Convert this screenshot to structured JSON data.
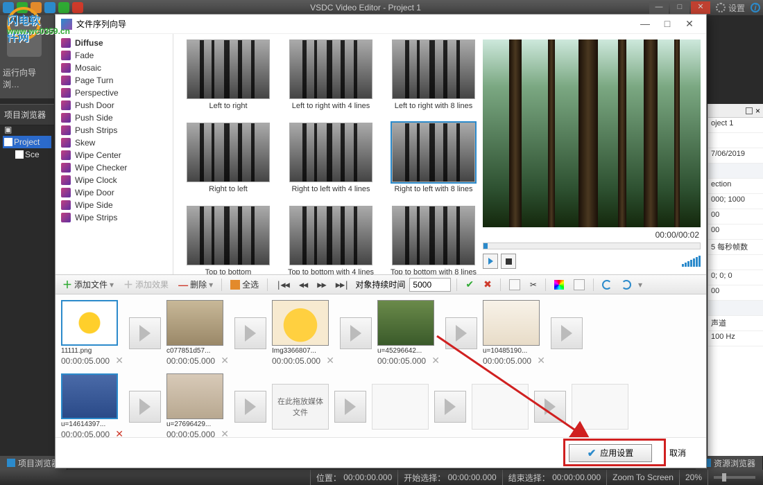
{
  "app": {
    "title": "VSDC Video Editor - Project 1"
  },
  "titlebar": {
    "settings": "设置"
  },
  "window_controls": {
    "min": "—",
    "max": "□",
    "close": "✕"
  },
  "watermark": {
    "line1": "闪电软件网",
    "line2": "www.wc0359.cn"
  },
  "left": {
    "wizard": "运行向导",
    "browse": "浏…",
    "browser_header": "项目浏览器",
    "project": "Project",
    "scene": "Sce"
  },
  "right_header": {
    "pin": "📌",
    "close": "×"
  },
  "properties": [
    {
      "v": "oject 1",
      "h": false
    },
    {
      "v": "",
      "h": false
    },
    {
      "v": "7/06/2019",
      "h": false
    },
    {
      "v": "",
      "h": true
    },
    {
      "v": "ection",
      "h": false
    },
    {
      "v": "000; 1000",
      "h": false
    },
    {
      "v": "00",
      "h": false
    },
    {
      "v": "00",
      "h": false
    },
    {
      "v": "5 每秒帧数",
      "h": false
    },
    {
      "v": "",
      "h": false
    },
    {
      "v": "0; 0; 0",
      "h": false
    },
    {
      "v": "00",
      "h": false
    },
    {
      "v": "",
      "h": true
    },
    {
      "v": "声道",
      "h": false
    },
    {
      "v": "100 Hz",
      "h": false
    }
  ],
  "dialog": {
    "title": "文件序列向导",
    "min": "—",
    "max": "□",
    "close": "✕",
    "effects": [
      "Diffuse",
      "Fade",
      "Mosaic",
      "Page Turn",
      "Perspective",
      "Push Door",
      "Push Side",
      "Push Strips",
      "Skew",
      "Wipe Center",
      "Wipe Checker",
      "Wipe Clock",
      "Wipe Door",
      "Wipe Side",
      "Wipe Strips"
    ],
    "effect_selected": 0,
    "thumbs": [
      "Left to right",
      "Left to right with 4 lines",
      "Left to right with 8 lines",
      "Right to left",
      "Right to left with 4 lines",
      "Right to left with 8 lines",
      "Top to bottom",
      "Top to bottom with 4 lines",
      "Top to bottom with 8 lines"
    ],
    "preview_time": "00:00/00:02",
    "toolbar": {
      "add_file": "添加文件",
      "add_effect": "添加效果",
      "delete": "删除",
      "select_all": "全选",
      "duration_label": "对象持续时间",
      "duration_value": "5000"
    },
    "clips_row1": [
      {
        "name": "11111.png",
        "dur": "00:00:05.000",
        "cls": "bg-sun",
        "sel": true
      },
      {
        "name": "c077851d57...",
        "dur": "00:00:05.000",
        "cls": "bg-cat"
      },
      {
        "name": "Img3366807...",
        "dur": "00:00:05.000",
        "cls": "bg-duck"
      },
      {
        "name": "u=45296642...",
        "dur": "00:00:05.000",
        "cls": "bg-squirrel"
      },
      {
        "name": "u=10485190...",
        "dur": "00:00:05.000",
        "cls": "bg-cheetah"
      }
    ],
    "clips_row2": [
      {
        "name": "u=14614397...",
        "dur": "00:00:05.000",
        "cls": "bg-bird",
        "sel": true,
        "delred": true
      },
      {
        "name": "u=27696429...",
        "dur": "00:00:05.000",
        "cls": "bg-kitten"
      }
    ],
    "placeholder_text": "在此拖放媒体文件",
    "apply": "应用设置",
    "cancel": "取消"
  },
  "bottom_tabs": {
    "project_browser": "项目浏览器",
    "resource_browser": "资源浏览器"
  },
  "status": {
    "pos_lbl": "位置：",
    "pos_val": "00:00:00.000",
    "start_lbl": "开始选择：",
    "start_val": "00:00:00.000",
    "end_lbl": "结束选择：",
    "end_val": "00:00:00.000",
    "zoom_lbl": "Zoom To Screen",
    "zoom_val": "20%"
  }
}
